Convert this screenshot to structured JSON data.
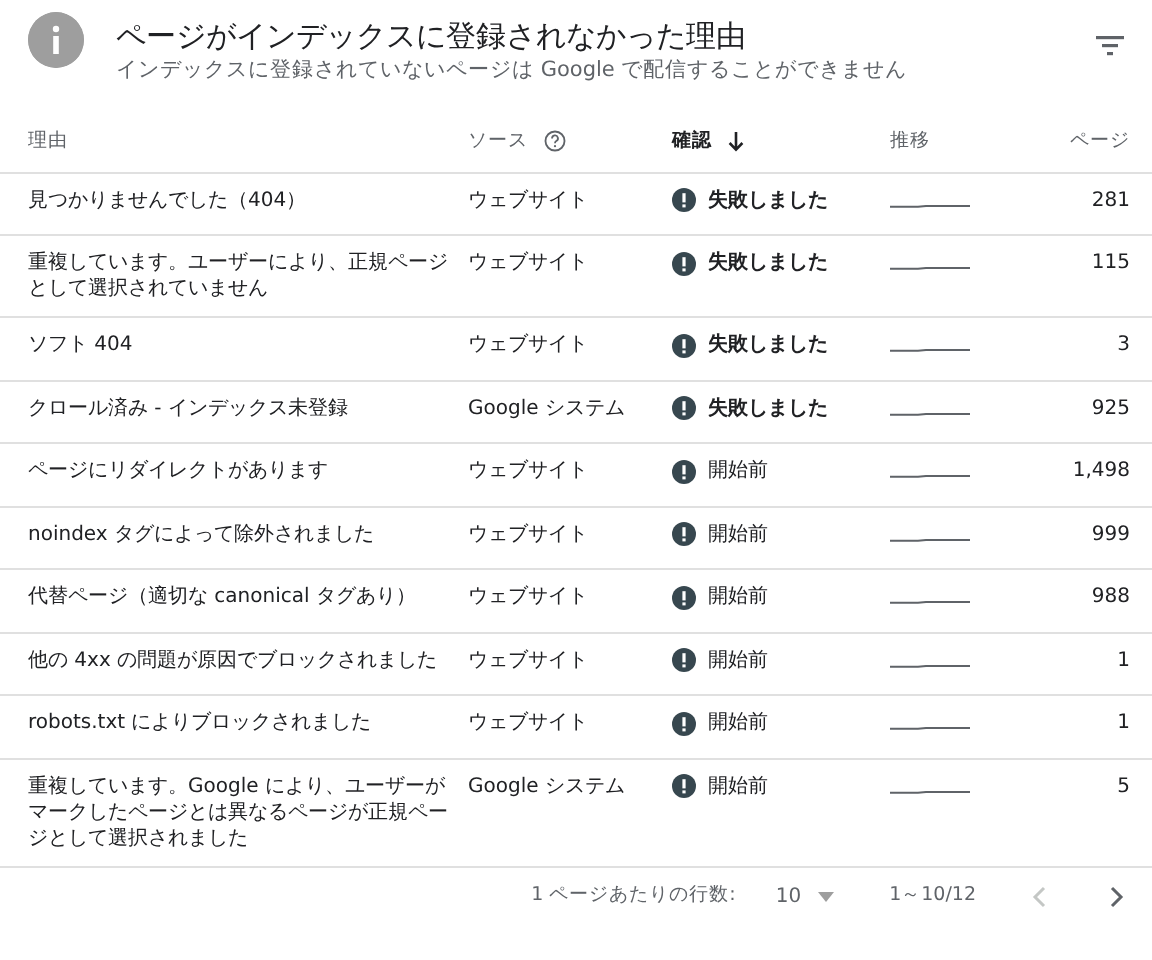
{
  "header": {
    "title": "ページがインデックスに登録されなかった理由",
    "subtitle": "インデックスに登録されていないページは Google で配信することができません"
  },
  "table": {
    "columns": [
      {
        "label": "理由",
        "sorted": false,
        "help": false
      },
      {
        "label": "ソース",
        "sorted": false,
        "help": true
      },
      {
        "label": "確認",
        "sorted": true,
        "help": false
      },
      {
        "label": "推移",
        "sorted": false,
        "help": false
      },
      {
        "label": "ページ",
        "sorted": false,
        "help": false
      }
    ],
    "rows": [
      {
        "reason": "見つかりませんでした（404）",
        "source": "ウェブサイト",
        "status": "失敗しました",
        "kind": "failed",
        "pages": "281"
      },
      {
        "reason": "重複しています。ユーザーにより、正規ページとして選択されていません",
        "source": "ウェブサイト",
        "status": "失敗しました",
        "kind": "failed",
        "pages": "115"
      },
      {
        "reason": "ソフト 404",
        "source": "ウェブサイト",
        "status": "失敗しました",
        "kind": "failed",
        "pages": "3"
      },
      {
        "reason": "クロール済み - インデックス未登録",
        "source": "Google システム",
        "status": "失敗しました",
        "kind": "failed",
        "pages": "925"
      },
      {
        "reason": "ページにリダイレクトがあります",
        "source": "ウェブサイト",
        "status": "開始前",
        "kind": "not_started",
        "pages": "1,498"
      },
      {
        "reason": "noindex タグによって除外されました",
        "source": "ウェブサイト",
        "status": "開始前",
        "kind": "not_started",
        "pages": "999"
      },
      {
        "reason": "代替ページ（適切な canonical タグあり）",
        "source": "ウェブサイト",
        "status": "開始前",
        "kind": "not_started",
        "pages": "988"
      },
      {
        "reason": "他の 4xx の問題が原因でブロックされました",
        "source": "ウェブサイト",
        "status": "開始前",
        "kind": "not_started",
        "pages": "1"
      },
      {
        "reason": "robots.txt によりブロックされました",
        "source": "ウェブサイト",
        "status": "開始前",
        "kind": "not_started",
        "pages": "1"
      },
      {
        "reason": "重複しています。Google により、ユーザーがマークしたページとは異なるページが正規ページとして選択されました",
        "source": "Google システム",
        "status": "開始前",
        "kind": "not_started",
        "pages": "5"
      }
    ]
  },
  "pagination": {
    "rows_label": "1 ページあたりの行数:",
    "rows_value": "10",
    "range": "1～10/12",
    "prev_disabled": true,
    "next_disabled": false
  }
}
